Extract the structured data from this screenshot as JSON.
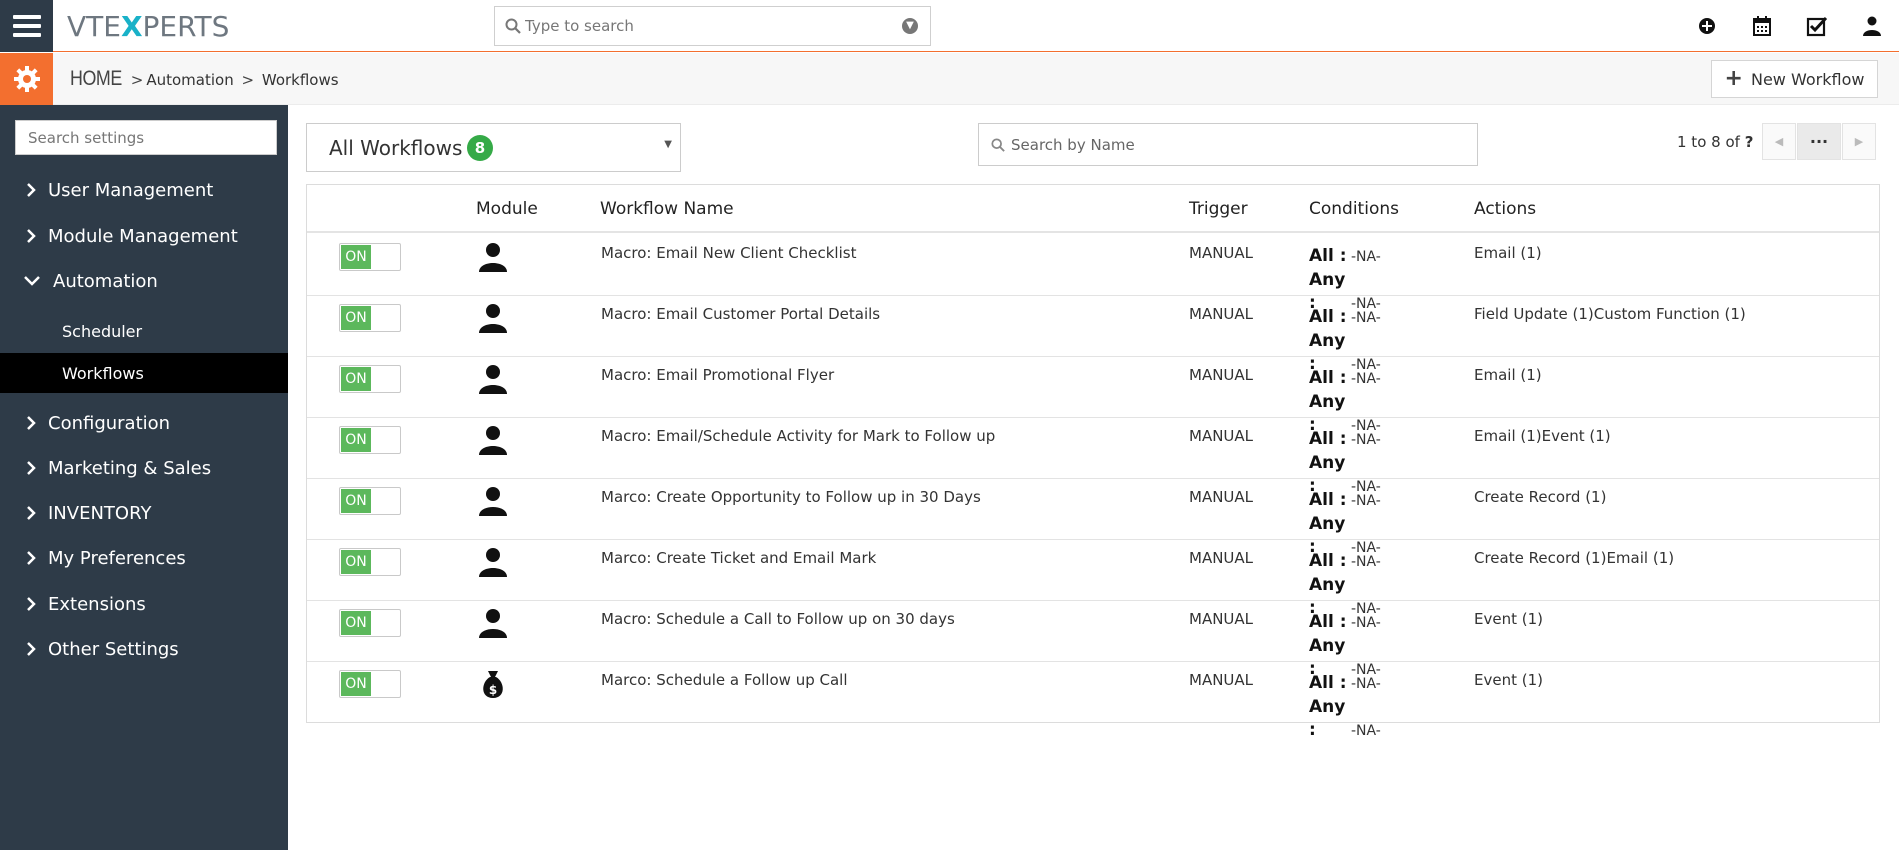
{
  "header": {
    "logo_pre": "VTE",
    "logo_x": "X",
    "logo_post": "PERTS",
    "search_placeholder": "Type to search",
    "icons": [
      "plus-circle-icon",
      "calendar-icon",
      "task-check-icon",
      "user-icon"
    ]
  },
  "breadcrumb": {
    "home": "HOME",
    "sep": ">",
    "level1": "Automation",
    "level2": "Workflows"
  },
  "new_workflow_label": "New Workflow",
  "sidebar": {
    "search_placeholder": "Search settings",
    "items": [
      {
        "label": "User Management"
      },
      {
        "label": "Module Management"
      },
      {
        "label": "Automation"
      },
      {
        "label": "Configuration"
      },
      {
        "label": "Marketing & Sales"
      },
      {
        "label": "INVENTORY"
      },
      {
        "label": "My Preferences"
      },
      {
        "label": "Extensions"
      },
      {
        "label": "Other Settings"
      }
    ],
    "subitems": [
      {
        "label": "Scheduler"
      },
      {
        "label": "Workflows"
      }
    ]
  },
  "filter": {
    "label": "All Workflows",
    "count": "8"
  },
  "name_search_placeholder": "Search by Name",
  "pager": {
    "range": "1 to 8",
    "of": "of",
    "total": "?"
  },
  "table": {
    "columns": [
      "Module",
      "Workflow Name",
      "Trigger",
      "Conditions",
      "Actions"
    ],
    "cond_all_label": "All :",
    "cond_any_label": "Any :",
    "rows": [
      {
        "toggle": "ON",
        "module_icon": "contact-person-icon",
        "name": "Macro: Email New Client Checklist",
        "trigger": "MANUAL",
        "all": "-NA-",
        "any": "-NA-",
        "actions": "Email (1)"
      },
      {
        "toggle": "ON",
        "module_icon": "contact-person-icon",
        "name": "Macro: Email Customer Portal Details",
        "trigger": "MANUAL",
        "all": "-NA-",
        "any": "-NA-",
        "actions": "Field Update (1)Custom Function (1)"
      },
      {
        "toggle": "ON",
        "module_icon": "contact-person-icon",
        "name": "Macro: Email Promotional Flyer",
        "trigger": "MANUAL",
        "all": "-NA-",
        "any": "-NA-",
        "actions": "Email (1)"
      },
      {
        "toggle": "ON",
        "module_icon": "contact-person-icon",
        "name": "Macro: Email/Schedule Activity for Mark to Follow up",
        "trigger": "MANUAL",
        "all": "-NA-",
        "any": "-NA-",
        "actions": "Email (1)Event (1)"
      },
      {
        "toggle": "ON",
        "module_icon": "contact-person-icon",
        "name": "Marco: Create Opportunity to Follow up in 30 Days",
        "trigger": "MANUAL",
        "all": "-NA-",
        "any": "-NA-",
        "actions": "Create Record (1)"
      },
      {
        "toggle": "ON",
        "module_icon": "contact-person-icon",
        "name": "Marco: Create Ticket and Email Mark",
        "trigger": "MANUAL",
        "all": "-NA-",
        "any": "-NA-",
        "actions": "Create Record (1)Email (1)"
      },
      {
        "toggle": "ON",
        "module_icon": "contact-person-icon",
        "name": "Macro: Schedule a Call to Follow up on 30 days",
        "trigger": "MANUAL",
        "all": "-NA-",
        "any": "-NA-",
        "actions": "Event (1)"
      },
      {
        "toggle": "ON",
        "module_icon": "money-bag-icon",
        "name": "Marco: Schedule a Follow up Call",
        "trigger": "MANUAL",
        "all": "-NA-",
        "any": "-NA-",
        "actions": "Event (1)"
      }
    ]
  },
  "colors": {
    "accent": "#f36f2f",
    "sidebar": "#2e3b48",
    "toggle_on": "#5cb85c",
    "badge": "#35aa47",
    "logo_x": "#19b1c8"
  }
}
